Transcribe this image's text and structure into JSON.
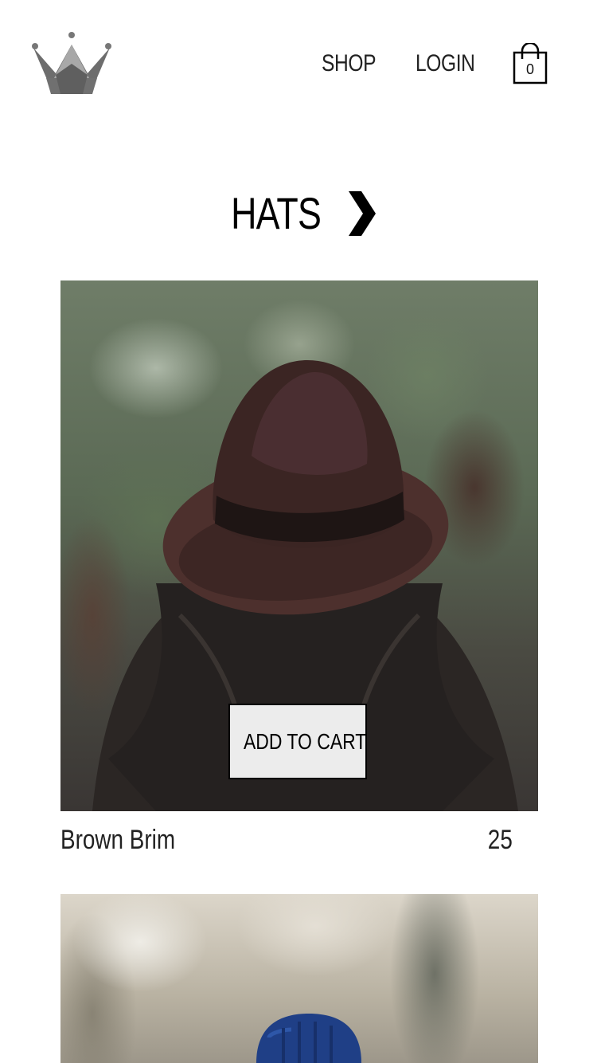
{
  "header": {
    "logo_icon": "crown-icon",
    "nav": [
      {
        "label": "SHOP"
      },
      {
        "label": "LOGIN"
      }
    ],
    "cart": {
      "icon": "shopping-bag-icon",
      "count": "0"
    }
  },
  "collection": {
    "title": "HATS",
    "arrow_icon": "chevron-right-icon"
  },
  "products": [
    {
      "name": "Brown Brim",
      "price": "25",
      "button_label": "ADD TO CART"
    },
    {
      "name": "",
      "price": "",
      "button_label": ""
    }
  ],
  "colors": {
    "background": "#ffffff",
    "text": "#000000",
    "logo_dark": "#6e6e6e",
    "logo_light": "#a9a9a9",
    "button_bg": "#ececec",
    "hat_brown": "#4a2c2a",
    "beanie_blue": "#1f3f86"
  }
}
